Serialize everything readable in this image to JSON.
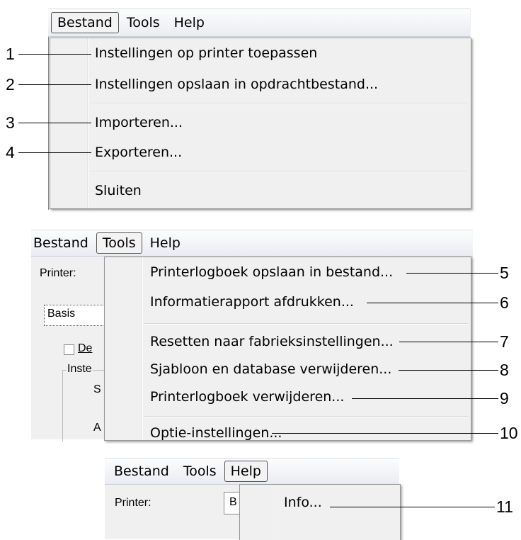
{
  "section1": {
    "menubar": [
      "Bestand",
      "Tools",
      "Help"
    ],
    "items": [
      "Instellingen op printer toepassen",
      "Instellingen opslaan in opdrachtbestand...",
      "Importeren...",
      "Exporteren...",
      "Sluiten"
    ],
    "callouts": [
      "1",
      "2",
      "3",
      "4"
    ]
  },
  "section2": {
    "menubar": [
      "Bestand",
      "Tools",
      "Help"
    ],
    "items": [
      "Printerlogboek opslaan in bestand...",
      "Informatierapport afdrukken...",
      "Resetten naar fabrieksinstellingen...",
      "Sjabloon en database verwijderen...",
      "Printerlogboek verwijderen...",
      "Optie-instellingen..."
    ],
    "callouts": [
      "5",
      "6",
      "7",
      "8",
      "9",
      "10"
    ],
    "background": {
      "printer_label": "Printer:",
      "tab": "Basis",
      "checkbox_label": "De",
      "group_label": "Inste",
      "row_s": "S",
      "row_a": "A"
    }
  },
  "section3": {
    "menubar": [
      "Bestand",
      "Tools",
      "Help"
    ],
    "items": [
      "Info..."
    ],
    "callouts": [
      "11"
    ],
    "background": {
      "printer_label": "Printer:",
      "field_text": "B"
    }
  }
}
